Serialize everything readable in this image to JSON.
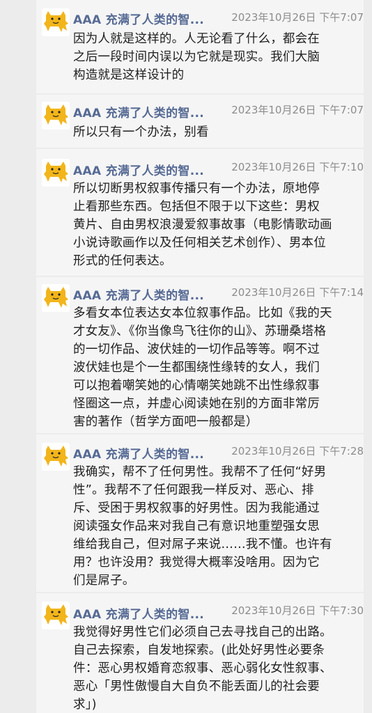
{
  "messages": [
    {
      "sender": "AAA 充满了人类的智...",
      "time": "2023年10月26日 下午7:07",
      "text": "因为人就是这样的。人无论看了什么，都会在\n之后一段时间内误以为它就是现实。我们大脑\n构造就是这样设计的",
      "avatar_icon": "yellow-cat-icon"
    },
    {
      "sender": "AAA 充满了人类的智...",
      "time": "2023年10月26日 下午7:07",
      "text": "所以只有一个办法，别看",
      "avatar_icon": "yellow-cat-icon"
    },
    {
      "sender": "AAA 充满了人类的智...",
      "time": "2023年10月26日 下午7:10",
      "text": "所以切断男权叙事传播只有一个办法，原地停\n止看那些东西。包括但不限于以下这些：男权\n黄片、自由男权浪漫爱叙事故事（电影情歌动画\n小说诗歌画作以及任何相关艺术创作）、男本位\n形式的任何表达。",
      "avatar_icon": "yellow-cat-icon"
    },
    {
      "sender": "AAA 充满了人类的智...",
      "time": "2023年10月26日 下午7:14",
      "text": "多看女本位表达女本位叙事作品。比如《我的天\n才女友》、《你当像鸟飞往你的山》、苏珊桑塔格\n的一切作品、波伏娃的一切作品等等。啊不过\n波伏娃也是个一生都围绕性缘转的女人，我们\n可以抱着嘲笑她的心情嘲笑她跳不出性缘叙事\n怪圈这一点，并虚心阅读她在别的方面非常厉\n害的著作（哲学方面吧一般都是）",
      "avatar_icon": "yellow-cat-icon"
    },
    {
      "sender": "AAA 充满了人类的智...",
      "time": "2023年10月26日 下午7:28",
      "text": "我确实，帮不了任何男性。我帮不了任何“好男\n性”。我帮不了任何跟我一样反对、恶心、排\n斥、受困于男权叙事的好男性。因为我能通过\n阅读强女作品来对我自己有意识地重塑强女思\n维给我自己，但对屌子来说……我不懂。也许有\n用？也许没用？我觉得大概率没啥用。因为它\n们是屌子。",
      "avatar_icon": "yellow-cat-icon"
    },
    {
      "sender": "AAA 充满了人类的智...",
      "time": "2023年10月26日 下午7:30",
      "text": "我觉得好男性它们必须自己去寻找自己的出路。\n自己去探索，自发地探索。(此处好男性必要条\n件：恶心男权婚育恋叙事、恶心弱化女性叙事、\n恶心「男性傲慢自大自负不能丢面儿的社会要\n求」)",
      "avatar_icon": "yellow-cat-icon"
    }
  ],
  "colors": {
    "page_bg": "#ececec",
    "card_bg": "#f5f5f5",
    "sender": "#566a94",
    "time": "#8c8c8c",
    "text": "#1f1f1f",
    "avatar": "#f2b51b"
  }
}
